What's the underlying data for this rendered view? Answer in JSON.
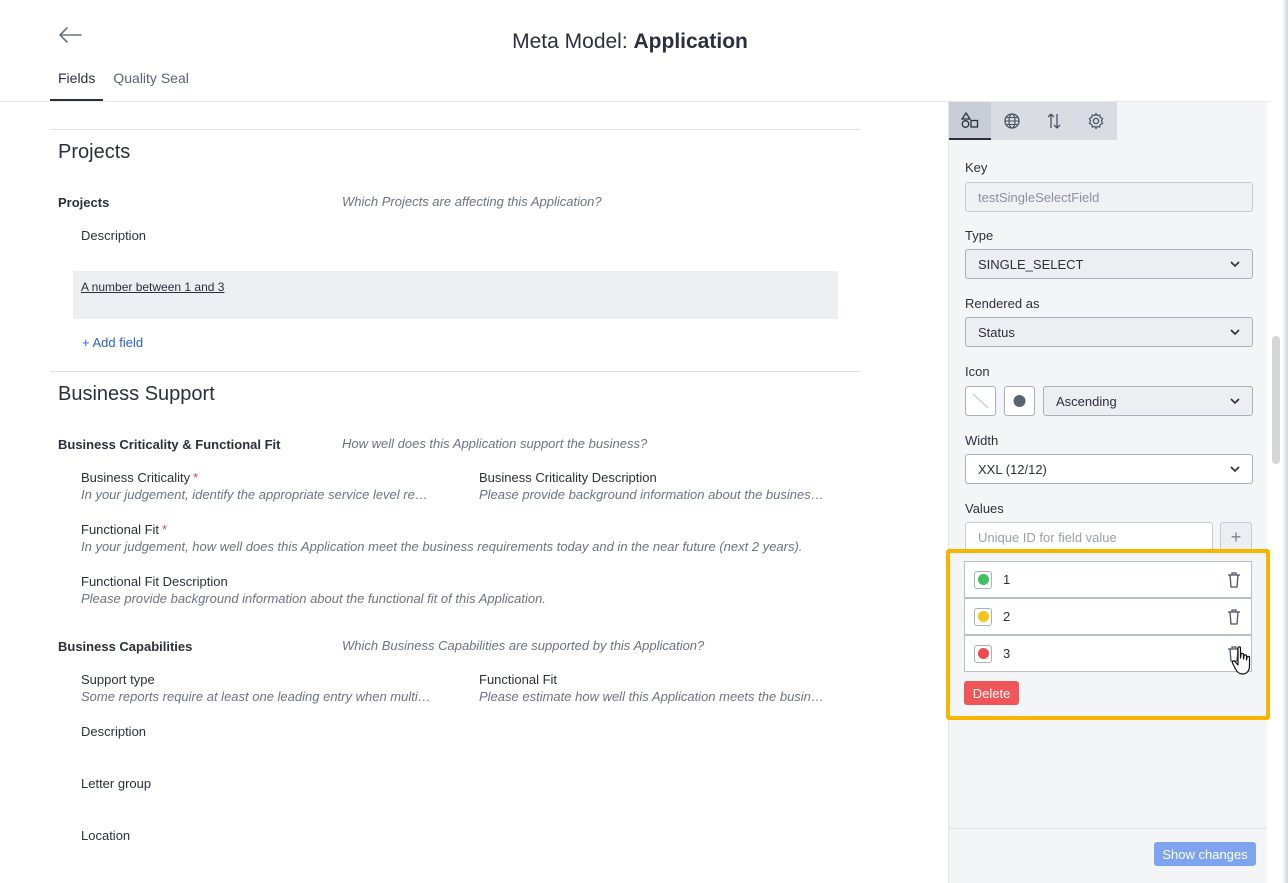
{
  "header": {
    "title_prefix": "Meta Model: ",
    "title_bold": "Application",
    "tabs": [
      {
        "label": "Fields",
        "active": true
      },
      {
        "label": "Quality Seal",
        "active": false
      }
    ]
  },
  "main": {
    "sections": [
      {
        "title": "Projects",
        "groups": [
          {
            "title": "Projects",
            "description": "Which Projects are affecting this Application?",
            "fields": [
              {
                "label": "Description"
              }
            ],
            "highlighted_field": "A number between 1 and 3",
            "add_field_label": "+ Add field"
          }
        ]
      },
      {
        "title": "Business Support",
        "groups": [
          {
            "title": "Business Criticality & Functional Fit",
            "description": "How well does this Application support the business?",
            "fields": [
              {
                "label": "Business Criticality",
                "required": "*",
                "help": "In your judgement, identify the appropriate service level required for this Application."
              },
              {
                "label": "Business Criticality Description",
                "help": "Please provide background information about the business criticality of this Application."
              },
              {
                "label": "Functional Fit",
                "required": "*",
                "help": "In your judgement, how well does this Application meet the business requirements today and in the near future (next 2 years)."
              },
              {
                "label": "Functional Fit Description",
                "help": "Please provide background information about the functional fit of this Application."
              }
            ]
          },
          {
            "title": "Business Capabilities",
            "description": "Which Business Capabilities are supported by this Application?",
            "fields": [
              {
                "label": "Support type",
                "help": "Some reports require at least one leading entry when multiple relations exist."
              },
              {
                "label": "Functional Fit",
                "help": "Please estimate how well this Application meets the business requirements for this capability."
              },
              {
                "label": "Description"
              },
              {
                "label": "Letter group"
              },
              {
                "label": "Location"
              }
            ]
          }
        ]
      }
    ]
  },
  "panel": {
    "tabs": [
      {
        "icon": "shapes-icon",
        "active": true
      },
      {
        "icon": "globe-icon",
        "active": false
      },
      {
        "icon": "sort-icon",
        "active": false
      },
      {
        "icon": "gear-icon",
        "active": false
      }
    ],
    "key_label": "Key",
    "key_value": "testSingleSelectField",
    "type_label": "Type",
    "type_value": "SINGLE_SELECT",
    "rendered_label": "Rendered as",
    "rendered_value": "Status",
    "icon_label": "Icon",
    "icon_order": "Ascending",
    "width_label": "Width",
    "width_value": "XXL (12/12)",
    "values_label": "Values",
    "value_placeholder": "Unique ID for field value",
    "add_symbol": "+",
    "values": [
      {
        "label": "1",
        "color": "#3cc35f"
      },
      {
        "label": "2",
        "color": "#f5c518"
      },
      {
        "label": "3",
        "color": "#ef4c51"
      }
    ],
    "delete_label": "Delete",
    "show_changes_label": "Show changes"
  },
  "colors": {
    "highlight": "#f7b500",
    "delete": "#f0555a",
    "primary_light": "#7ea4ef",
    "link": "#2a5fd0"
  }
}
